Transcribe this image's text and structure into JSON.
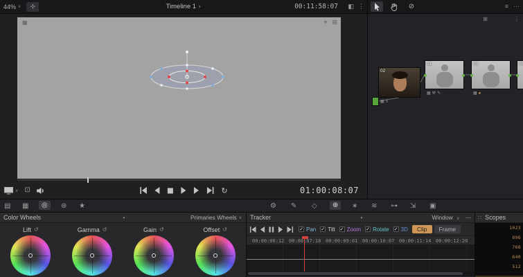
{
  "icons": {
    "dropdown": "∨",
    "more": "⋯",
    "menu": "≡",
    "reset": "↺",
    "check": "✓",
    "dot": "•",
    "wand": "⊹",
    "split": "◧",
    "kebab": "⋮",
    "grid": "⊞",
    "crop": "⌖",
    "gallery": "▤",
    "lut": "▦",
    "wheels": "◎",
    "hdr": "⊛",
    "star": "★",
    "wrench": "⚙",
    "eyedropper": "✎",
    "window": "◇",
    "tracker": "⊕",
    "magic": "∗",
    "blur": "≋",
    "key": "⊶",
    "sizing": "⇲",
    "stereo": "▣",
    "bypass": "⊘",
    "expand": "⊡",
    "loop": "↻",
    "thumb_grid": "▦",
    "thumb_menu": "≡",
    "thumb_tools": "⚒",
    "thumb_pencil": "✎",
    "mask_dot": "●",
    "scope_grid": "∷"
  },
  "viewer": {
    "zoom_level": "44%",
    "timeline_name": "Timeline 1",
    "clip_timecode": "00:11:58:07",
    "playhead_timecode": "01:00:08:07"
  },
  "node_graph": {
    "nodes": [
      {
        "id": "02"
      },
      {
        "id": "01"
      },
      {
        "id": "03"
      },
      {
        "id": "04"
      }
    ]
  },
  "color_wheels": {
    "title": "Color Wheels",
    "mode": "Primaries Wheels",
    "wheels": [
      {
        "label": "Lift"
      },
      {
        "label": "Gamma"
      },
      {
        "label": "Gain"
      },
      {
        "label": "Offset"
      }
    ]
  },
  "tracker": {
    "title": "Tracker",
    "window_menu": "Window",
    "features": [
      {
        "label": "Pan",
        "checked": true,
        "color": "#7db8d8"
      },
      {
        "label": "Tilt",
        "checked": true,
        "color": "#cfcfcf"
      },
      {
        "label": "Zoom",
        "checked": true,
        "color": "#b07ad8"
      },
      {
        "label": "Rotate",
        "checked": true,
        "color": "#62c2c2"
      },
      {
        "label": "3D",
        "checked": true,
        "color": "#6a8ad8"
      }
    ],
    "clip_button": "Clip",
    "frame_button": "Frame",
    "timeline_timecodes": [
      "00:00:06:12",
      "00:00:07:18",
      "00:00:09:01",
      "00:00:10:07",
      "00:00:11:14",
      "00:00:12:20"
    ]
  },
  "scopes": {
    "title": "Scopes",
    "scale_values": [
      "1023",
      "896",
      "768",
      "640",
      "512"
    ],
    "scale_color": "#c08d52"
  },
  "colors": {
    "clip_active_bg": "#ce9757",
    "clip_active_text": "#1e1e1e",
    "playhead": "#d84040"
  }
}
